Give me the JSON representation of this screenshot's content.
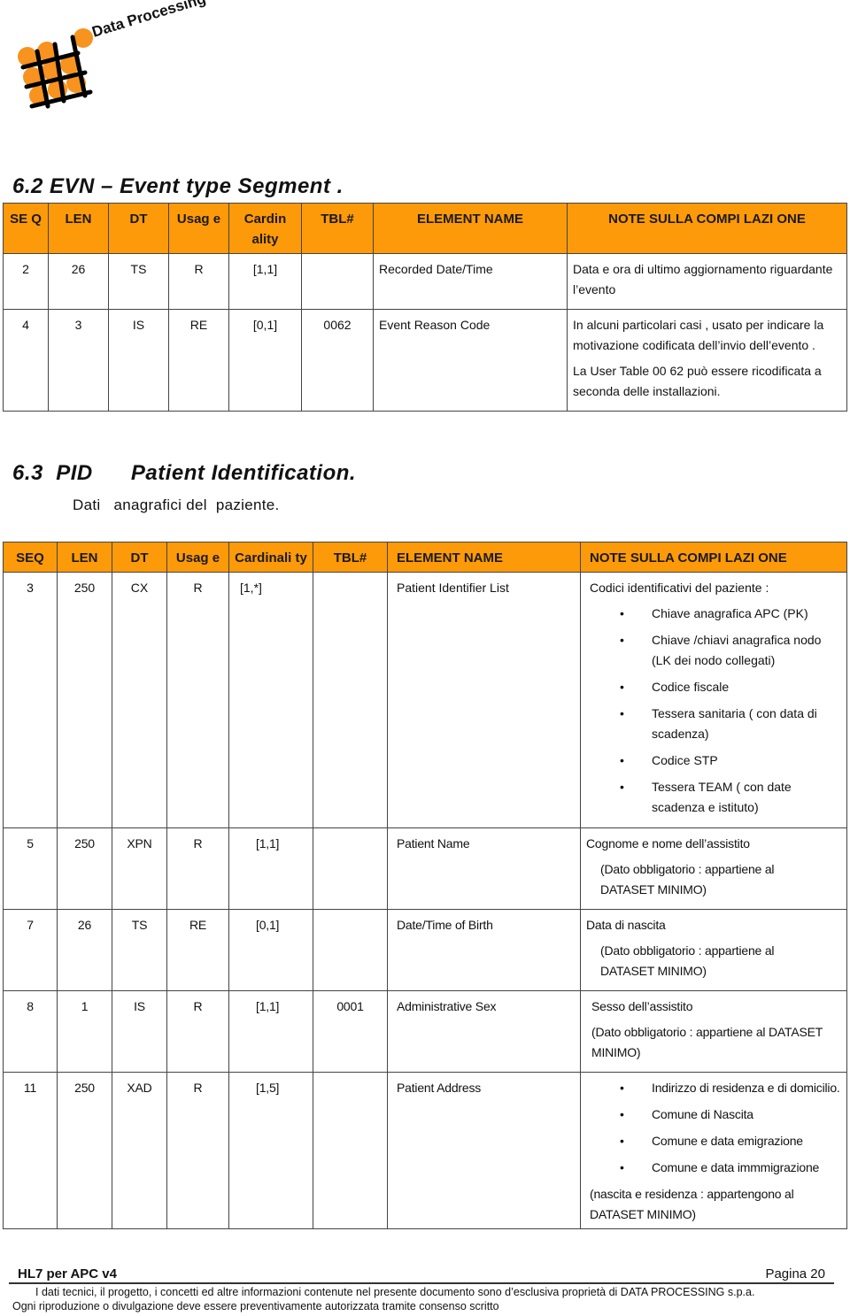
{
  "logo": {
    "text": "Data Processing",
    "icon": "dot-grid-logo-icon",
    "dot_color": "#f7931e"
  },
  "colors": {
    "header_bg": "#fd9a0a",
    "border": "#444444"
  },
  "evn": {
    "heading": "6.2  EVN – Event type Segment .",
    "columns": [
      "SE Q",
      "LEN",
      "DT",
      "Usag e",
      "Cardin ality",
      "TBL#",
      "ELEMENT NAME",
      "NOTE SULLA COMPI LAZI ONE"
    ],
    "rows": [
      {
        "seq": "2",
        "len": "26",
        "dt": "TS",
        "usage": "R",
        "cardinality": "[1,1]",
        "tbl": "",
        "element": "Recorded Date/Time",
        "note": [
          "Data e ora di ultimo aggiornamento riguardante l’evento"
        ]
      },
      {
        "seq": "4",
        "len": "3",
        "dt": "IS",
        "usage": "RE",
        "cardinality": "[0,1]",
        "tbl": "0062",
        "element": "Event Reason Code",
        "note": [
          "In alcuni particolari casi , usato per indicare la motivazione codificata dell’invio dell’evento .",
          "La User Table 00 62 può essere ricodificata a seconda delle installazioni."
        ]
      }
    ]
  },
  "pid": {
    "heading_code": "6.3  PID",
    "heading_title": "Patient Identification.",
    "subtitle": "Dati   anagrafici del  paziente.",
    "columns": [
      "SEQ",
      "LEN",
      "DT",
      "Usag e",
      "Cardinali ty",
      "TBL#",
      "ELEMENT NAME",
      "NOTE SULLA COMPI LAZI ONE"
    ],
    "rows": [
      {
        "seq": "3",
        "len": "250",
        "dt": "CX",
        "usage": "R",
        "cardinality": "[1,*]",
        "tbl": "",
        "element": "Patient Identifier List",
        "note_intro": "Codici identificativi del paziente :",
        "bullets": [
          "Chiave anagrafica APC (PK)",
          "Chiave /chiavi  anagrafica nodo (LK dei nodo collegati)",
          "Codice fiscale",
          "Tessera sanitaria ( con  data di scadenza)",
          "Codice STP",
          "Tessera TEAM ( con date scadenza e istituto)"
        ]
      },
      {
        "seq": "5",
        "len": "250",
        "dt": "XPN",
        "usage": "R",
        "cardinality": "[1,1]",
        "tbl": "",
        "element": "Patient Name",
        "note": [
          "Cognome e nome dell’assistito",
          "(Dato obbligatorio : appartiene al DATASET MINIMO)"
        ]
      },
      {
        "seq": "7",
        "len": "26",
        "dt": "TS",
        "usage": "RE",
        "cardinality": "[0,1]",
        "tbl": "",
        "element": "Date/Time of Birth",
        "note": [
          "Data di nascita",
          "(Dato obbligatorio : appartiene al DATASET MINIMO)"
        ]
      },
      {
        "seq": "8",
        "len": "1",
        "dt": "IS",
        "usage": "R",
        "cardinality": "[1,1]",
        "tbl": "0001",
        "element": "Administrative Sex",
        "note": [
          "Sesso dell’assistito",
          "(Dato obbligatorio : appartiene al DATASET MINIMO)"
        ]
      },
      {
        "seq": "11",
        "len": "250",
        "dt": "XAD",
        "usage": "R",
        "cardinality": "[1,5]",
        "tbl": "",
        "element": "Patient Address",
        "bullets": [
          "Indirizzo di residenza  e di domicilio.",
          "Comune di Nascita",
          "Comune  e data emigrazione",
          "Comune e data immmigrazione"
        ],
        "note_outro": "(nascita e residenza : appartengono al DATASET MINIMO)"
      }
    ]
  },
  "footer": {
    "title": "HL7 per APC v4",
    "page": "Pagina 20",
    "line1": "I dati tecnici, il progetto, i concetti ed altre informazioni contenute nel presente documento sono d’esclusiva proprietà di DATA PROCESSING s.p.a.",
    "line2": "Ogni riproduzione o divulgazione deve essere preventivamente autorizzata tramite consenso scritto"
  }
}
